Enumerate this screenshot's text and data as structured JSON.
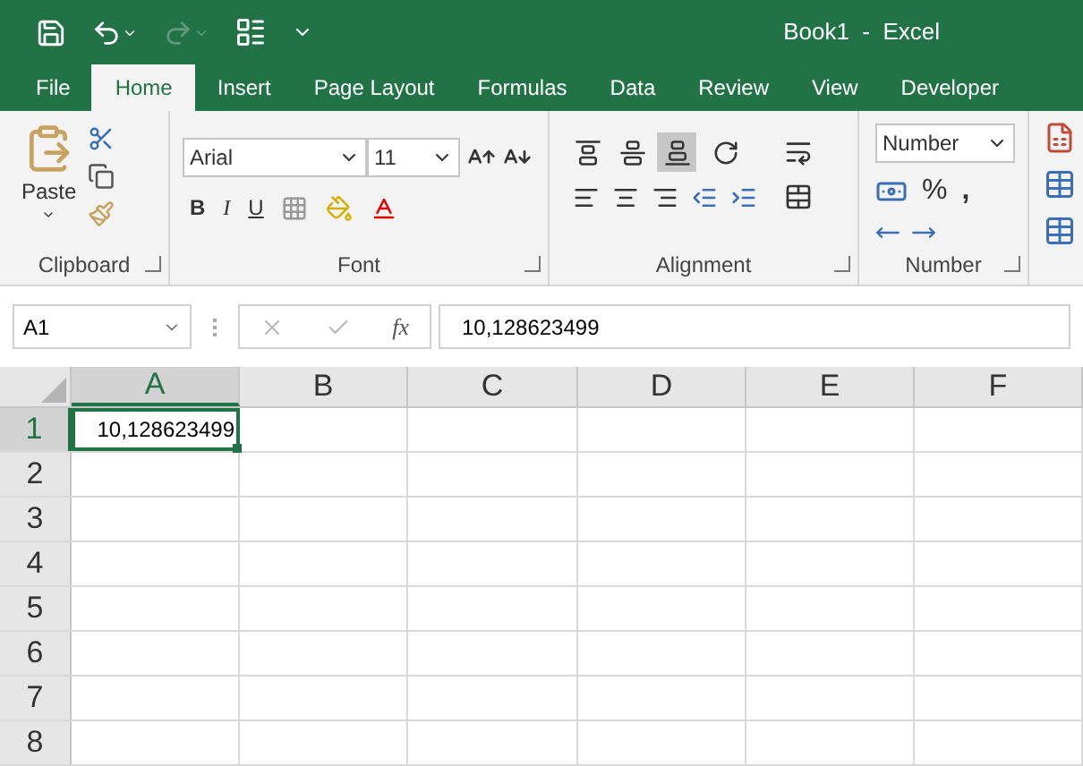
{
  "window": {
    "title": "Book1  -  Excel"
  },
  "tabs": [
    {
      "label": "File",
      "selected": false
    },
    {
      "label": "Home",
      "selected": true
    },
    {
      "label": "Insert",
      "selected": false
    },
    {
      "label": "Page Layout",
      "selected": false
    },
    {
      "label": "Formulas",
      "selected": false
    },
    {
      "label": "Data",
      "selected": false
    },
    {
      "label": "Review",
      "selected": false
    },
    {
      "label": "View",
      "selected": false
    },
    {
      "label": "Developer",
      "selected": false
    }
  ],
  "ribbon": {
    "clipboard": {
      "label": "Clipboard",
      "paste": "Paste"
    },
    "font": {
      "label": "Font",
      "name": "Arial",
      "size": "11",
      "bold": "B",
      "italic": "I",
      "underline": "U"
    },
    "alignment": {
      "label": "Alignment",
      "vertical_align": [
        {
          "kind": "top",
          "selected": false
        },
        {
          "kind": "middle",
          "selected": false
        },
        {
          "kind": "bottom",
          "selected": true
        }
      ]
    },
    "number": {
      "label": "Number",
      "format": "Number",
      "percent": "%",
      "comma": ","
    }
  },
  "formula_bar": {
    "name_box": "A1",
    "fx": "fx",
    "value": "10,128623499"
  },
  "grid": {
    "columns": [
      {
        "label": "A",
        "selected": true
      },
      {
        "label": "B",
        "selected": false
      },
      {
        "label": "C",
        "selected": false
      },
      {
        "label": "D",
        "selected": false
      },
      {
        "label": "E",
        "selected": false
      },
      {
        "label": "F",
        "selected": false
      }
    ],
    "rows": [
      {
        "label": "1",
        "selected": true,
        "cells": [
          "10,128623499"
        ]
      },
      {
        "label": "2",
        "selected": false,
        "cells": []
      },
      {
        "label": "3",
        "selected": false,
        "cells": []
      },
      {
        "label": "4",
        "selected": false,
        "cells": []
      },
      {
        "label": "5",
        "selected": false,
        "cells": []
      },
      {
        "label": "6",
        "selected": false,
        "cells": []
      },
      {
        "label": "7",
        "selected": false,
        "cells": []
      },
      {
        "label": "8",
        "selected": false,
        "cells": []
      }
    ]
  }
}
